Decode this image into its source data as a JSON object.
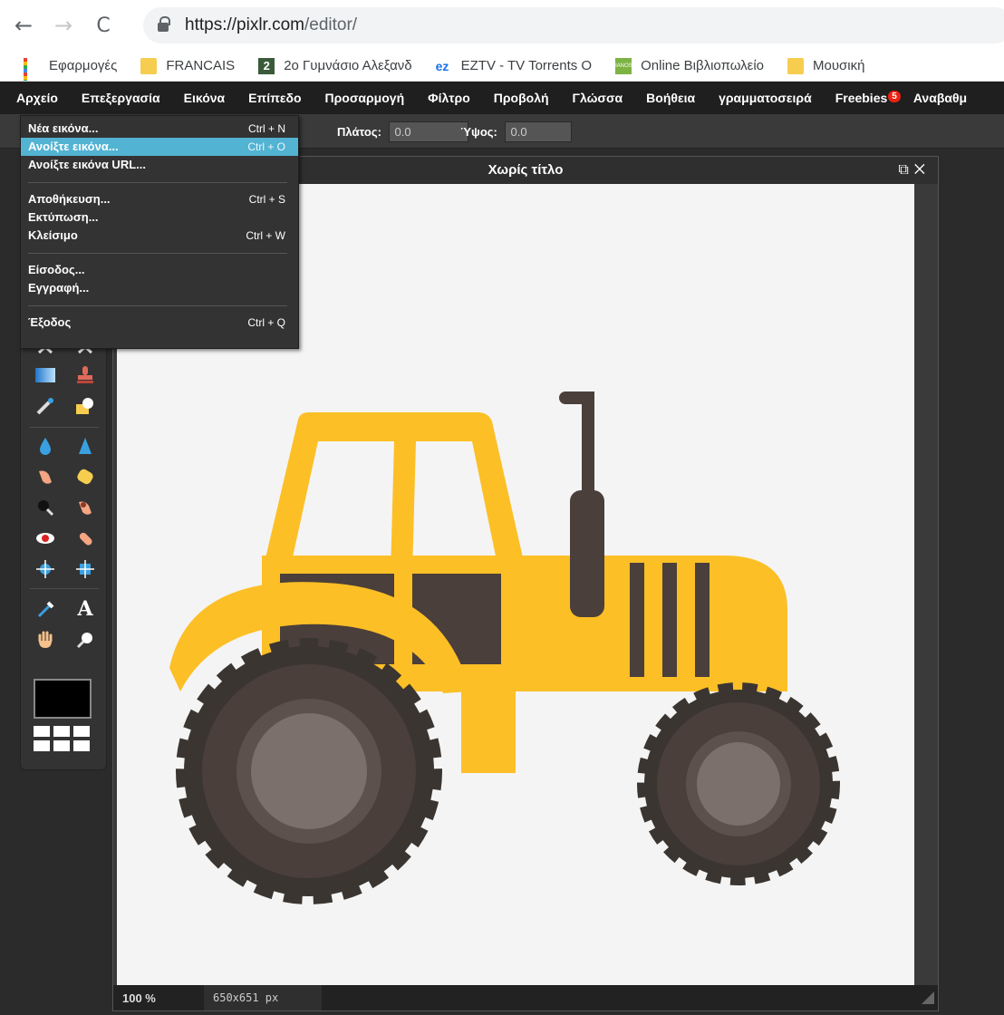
{
  "browser": {
    "url_host": "https://pixlr.com",
    "url_path": "/editor/",
    "bookmarks": [
      {
        "label": "Εφαρμογές",
        "icon": "apps-grid-icon"
      },
      {
        "label": "FRANCAIS",
        "icon": "folder-icon"
      },
      {
        "label": "2ο Γυμνάσιο Αλεξανδ",
        "icon": "site-2-icon"
      },
      {
        "label": "EZTV - TV Torrents O",
        "icon": "eztv-icon"
      },
      {
        "label": "Online Βιβλιοπωλείο",
        "icon": "ianos-icon"
      },
      {
        "label": "Μουσική",
        "icon": "folder-icon"
      }
    ]
  },
  "menubar": {
    "items": [
      "Αρχείο",
      "Επεξεργασία",
      "Εικόνα",
      "Επίπεδο",
      "Προσαρμογή",
      "Φίλτρο",
      "Προβολή",
      "Γλώσσα",
      "Βοήθεια",
      "γραμματοσειρά",
      "Freebies",
      "Αναβαθμ"
    ],
    "freebies_badge": "5"
  },
  "options": {
    "width_label": "Πλάτος:",
    "width_value": "0.0",
    "height_label": "Ύψος:",
    "height_value": "0.0"
  },
  "file_menu": {
    "items": [
      {
        "label": "Νέα εικόνα...",
        "shortcut": "Ctrl + N"
      },
      {
        "label": "Ανοίξτε εικόνα...",
        "shortcut": "Ctrl + O",
        "active": true
      },
      {
        "label": "Ανοίξτε εικόνα URL...",
        "shortcut": ""
      },
      {
        "label": "Αποθήκευση...",
        "shortcut": "Ctrl + S"
      },
      {
        "label": "Εκτύπωση...",
        "shortcut": ""
      },
      {
        "label": "Κλείσιμο",
        "shortcut": "Ctrl + W"
      },
      {
        "label": "Είσοδος...",
        "shortcut": ""
      },
      {
        "label": "Εγγραφή...",
        "shortcut": ""
      },
      {
        "label": "Έξοδος",
        "shortcut": "Ctrl + Q"
      }
    ]
  },
  "document": {
    "title": "Χωρίς τίτλο",
    "zoom": "100 %",
    "dimensions": "650x651 px"
  },
  "colors": {
    "tractor_yellow": "#fcbf26",
    "tractor_dark": "#4a3f3a",
    "tire": "#3a3530",
    "hub": "#7b706c",
    "menu_highlight": "#53b3d2"
  }
}
